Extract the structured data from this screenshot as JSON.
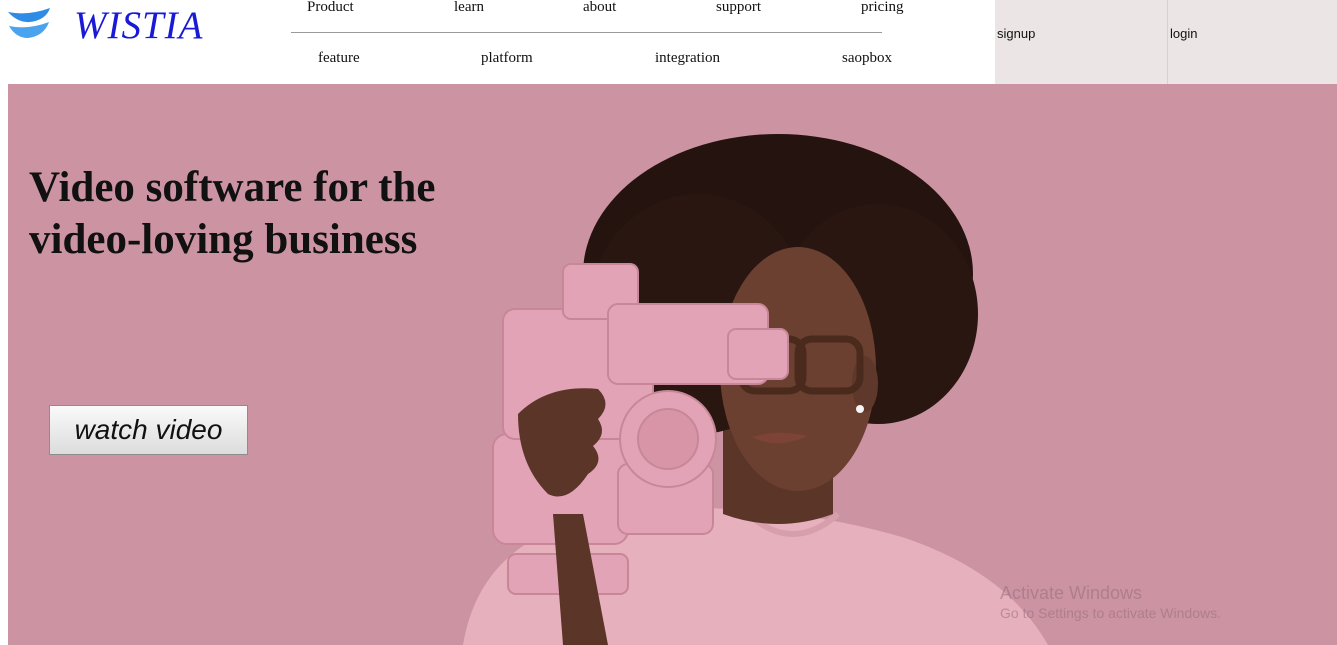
{
  "brand": {
    "name": "WISTIA",
    "logo_icon": "wistia-wave-icon",
    "brand_color": "#1a1ad6"
  },
  "nav": {
    "primary": [
      "Product",
      "learn",
      "about",
      "support",
      "pricing"
    ],
    "secondary": [
      "feature",
      "platform",
      "integration",
      "saopbox"
    ]
  },
  "auth": {
    "signup": "signup",
    "login": "login"
  },
  "hero": {
    "headline": "Video software for the video-loving business",
    "cta": "watch video",
    "background_color": "#cc93a3",
    "image_subject": "woman-holding-pink-camcorder"
  },
  "watermark": {
    "title": "Activate Windows",
    "subtitle": "Go to Settings to activate Windows."
  }
}
